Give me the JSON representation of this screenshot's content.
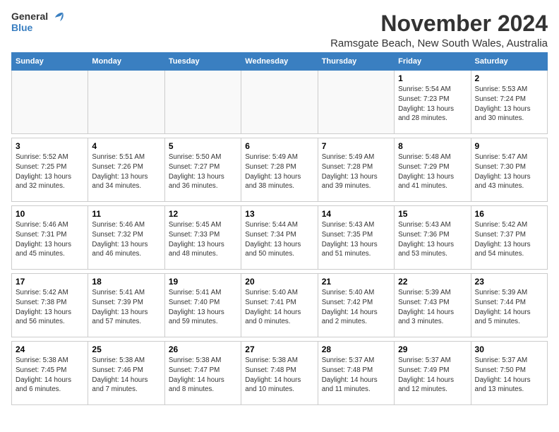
{
  "logo": {
    "general": "General",
    "blue": "Blue"
  },
  "title": "November 2024",
  "location": "Ramsgate Beach, New South Wales, Australia",
  "weekdays": [
    "Sunday",
    "Monday",
    "Tuesday",
    "Wednesday",
    "Thursday",
    "Friday",
    "Saturday"
  ],
  "weeks": [
    [
      {
        "day": "",
        "info": ""
      },
      {
        "day": "",
        "info": ""
      },
      {
        "day": "",
        "info": ""
      },
      {
        "day": "",
        "info": ""
      },
      {
        "day": "",
        "info": ""
      },
      {
        "day": "1",
        "info": "Sunrise: 5:54 AM\nSunset: 7:23 PM\nDaylight: 13 hours\nand 28 minutes."
      },
      {
        "day": "2",
        "info": "Sunrise: 5:53 AM\nSunset: 7:24 PM\nDaylight: 13 hours\nand 30 minutes."
      }
    ],
    [
      {
        "day": "3",
        "info": "Sunrise: 5:52 AM\nSunset: 7:25 PM\nDaylight: 13 hours\nand 32 minutes."
      },
      {
        "day": "4",
        "info": "Sunrise: 5:51 AM\nSunset: 7:26 PM\nDaylight: 13 hours\nand 34 minutes."
      },
      {
        "day": "5",
        "info": "Sunrise: 5:50 AM\nSunset: 7:27 PM\nDaylight: 13 hours\nand 36 minutes."
      },
      {
        "day": "6",
        "info": "Sunrise: 5:49 AM\nSunset: 7:28 PM\nDaylight: 13 hours\nand 38 minutes."
      },
      {
        "day": "7",
        "info": "Sunrise: 5:49 AM\nSunset: 7:28 PM\nDaylight: 13 hours\nand 39 minutes."
      },
      {
        "day": "8",
        "info": "Sunrise: 5:48 AM\nSunset: 7:29 PM\nDaylight: 13 hours\nand 41 minutes."
      },
      {
        "day": "9",
        "info": "Sunrise: 5:47 AM\nSunset: 7:30 PM\nDaylight: 13 hours\nand 43 minutes."
      }
    ],
    [
      {
        "day": "10",
        "info": "Sunrise: 5:46 AM\nSunset: 7:31 PM\nDaylight: 13 hours\nand 45 minutes."
      },
      {
        "day": "11",
        "info": "Sunrise: 5:46 AM\nSunset: 7:32 PM\nDaylight: 13 hours\nand 46 minutes."
      },
      {
        "day": "12",
        "info": "Sunrise: 5:45 AM\nSunset: 7:33 PM\nDaylight: 13 hours\nand 48 minutes."
      },
      {
        "day": "13",
        "info": "Sunrise: 5:44 AM\nSunset: 7:34 PM\nDaylight: 13 hours\nand 50 minutes."
      },
      {
        "day": "14",
        "info": "Sunrise: 5:43 AM\nSunset: 7:35 PM\nDaylight: 13 hours\nand 51 minutes."
      },
      {
        "day": "15",
        "info": "Sunrise: 5:43 AM\nSunset: 7:36 PM\nDaylight: 13 hours\nand 53 minutes."
      },
      {
        "day": "16",
        "info": "Sunrise: 5:42 AM\nSunset: 7:37 PM\nDaylight: 13 hours\nand 54 minutes."
      }
    ],
    [
      {
        "day": "17",
        "info": "Sunrise: 5:42 AM\nSunset: 7:38 PM\nDaylight: 13 hours\nand 56 minutes."
      },
      {
        "day": "18",
        "info": "Sunrise: 5:41 AM\nSunset: 7:39 PM\nDaylight: 13 hours\nand 57 minutes."
      },
      {
        "day": "19",
        "info": "Sunrise: 5:41 AM\nSunset: 7:40 PM\nDaylight: 13 hours\nand 59 minutes."
      },
      {
        "day": "20",
        "info": "Sunrise: 5:40 AM\nSunset: 7:41 PM\nDaylight: 14 hours\nand 0 minutes."
      },
      {
        "day": "21",
        "info": "Sunrise: 5:40 AM\nSunset: 7:42 PM\nDaylight: 14 hours\nand 2 minutes."
      },
      {
        "day": "22",
        "info": "Sunrise: 5:39 AM\nSunset: 7:43 PM\nDaylight: 14 hours\nand 3 minutes."
      },
      {
        "day": "23",
        "info": "Sunrise: 5:39 AM\nSunset: 7:44 PM\nDaylight: 14 hours\nand 5 minutes."
      }
    ],
    [
      {
        "day": "24",
        "info": "Sunrise: 5:38 AM\nSunset: 7:45 PM\nDaylight: 14 hours\nand 6 minutes."
      },
      {
        "day": "25",
        "info": "Sunrise: 5:38 AM\nSunset: 7:46 PM\nDaylight: 14 hours\nand 7 minutes."
      },
      {
        "day": "26",
        "info": "Sunrise: 5:38 AM\nSunset: 7:47 PM\nDaylight: 14 hours\nand 8 minutes."
      },
      {
        "day": "27",
        "info": "Sunrise: 5:38 AM\nSunset: 7:48 PM\nDaylight: 14 hours\nand 10 minutes."
      },
      {
        "day": "28",
        "info": "Sunrise: 5:37 AM\nSunset: 7:48 PM\nDaylight: 14 hours\nand 11 minutes."
      },
      {
        "day": "29",
        "info": "Sunrise: 5:37 AM\nSunset: 7:49 PM\nDaylight: 14 hours\nand 12 minutes."
      },
      {
        "day": "30",
        "info": "Sunrise: 5:37 AM\nSunset: 7:50 PM\nDaylight: 14 hours\nand 13 minutes."
      }
    ]
  ]
}
